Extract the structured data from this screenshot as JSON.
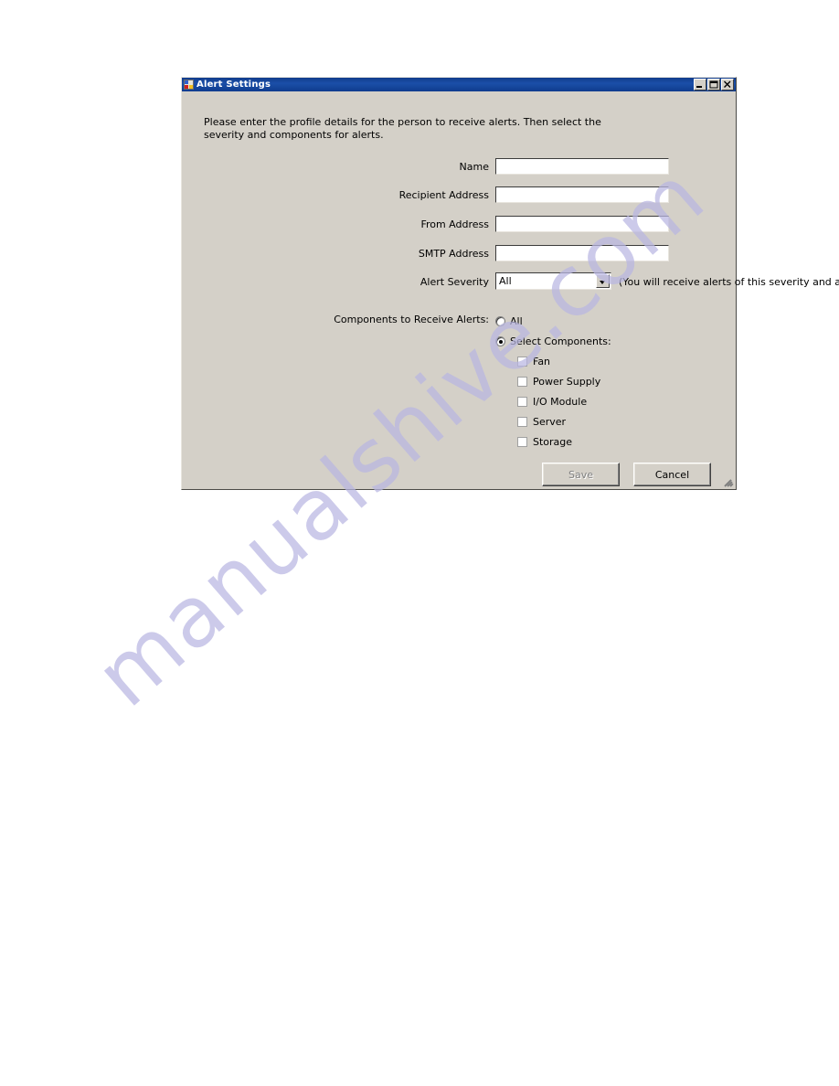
{
  "page": {
    "background": "#ffffff",
    "watermark": "manualshive.com",
    "watermark_color": "#b9b7e2"
  },
  "dialog": {
    "title": "Alert Settings",
    "title_icon": "form-icon",
    "titlebar_color": "#1b4fa8",
    "face_color": "#d4d0c8",
    "window_buttons": [
      {
        "name": "minimize-button",
        "glyph": "minimize-icon"
      },
      {
        "name": "maximize-button",
        "glyph": "maximize-icon"
      },
      {
        "name": "close-button",
        "glyph": "close-icon"
      }
    ],
    "intro_text": "Please enter the profile details for the person to receive alerts. Then select the severity and components for alerts.",
    "fields": [
      {
        "label": "Name",
        "value": "",
        "placeholder": ""
      },
      {
        "label": "Recipient Address",
        "value": "",
        "placeholder": ""
      },
      {
        "label": "From Address",
        "value": "",
        "placeholder": ""
      },
      {
        "label": "SMTP Address",
        "value": "",
        "placeholder": ""
      }
    ],
    "severity": {
      "label": "Alert Severity",
      "selected": "All",
      "hint": "(You will receive alerts of this severity and above)",
      "arrow_icon": "chevron-down-icon"
    },
    "components": {
      "label": "Components to Receive Alerts:",
      "radios": [
        {
          "label": "All",
          "selected": false
        },
        {
          "label": "Select Components:",
          "selected": true
        }
      ],
      "checkboxes": [
        {
          "label": "Fan",
          "checked": false
        },
        {
          "label": "Power Supply",
          "checked": false
        },
        {
          "label": "I/O Module",
          "checked": false
        },
        {
          "label": "Server",
          "checked": false
        },
        {
          "label": "Storage",
          "checked": false
        }
      ]
    },
    "buttons": {
      "save": {
        "label": "Save",
        "disabled": true
      },
      "cancel": {
        "label": "Cancel",
        "disabled": false
      }
    },
    "resize_grip": "resize-grip-icon"
  }
}
